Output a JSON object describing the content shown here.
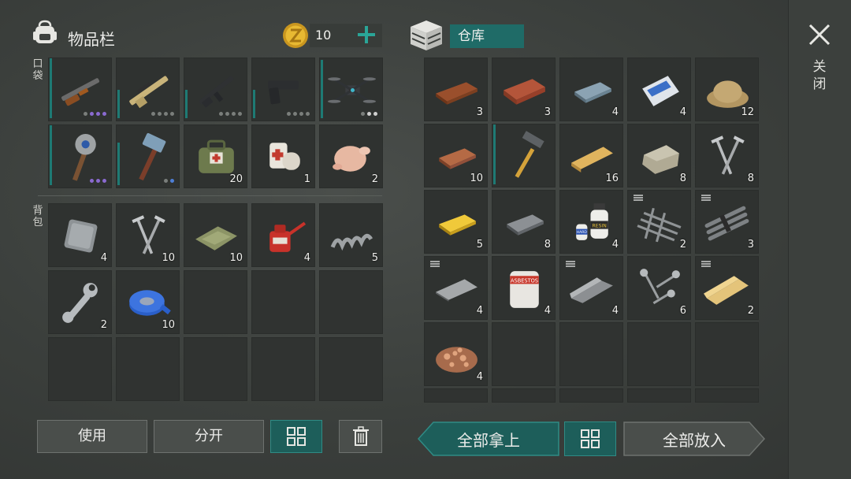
{
  "inventory": {
    "title": "物品栏",
    "coins": "10",
    "pocket_label": "口袋",
    "backpack_label": "背包",
    "pocket_slots": [
      {
        "icon": "shotgun-icon",
        "qty": "",
        "dots": [
          "off",
          "on",
          "on",
          "on"
        ]
      },
      {
        "icon": "rifle-icon",
        "qty": "",
        "dots": [
          "off",
          "off",
          "off",
          "off"
        ]
      },
      {
        "icon": "assault-rifle-icon",
        "qty": "",
        "dots": [
          "off",
          "off",
          "off",
          "off"
        ]
      },
      {
        "icon": "pistol-icon",
        "qty": "",
        "dots": [
          "off",
          "off",
          "off",
          "off"
        ]
      },
      {
        "icon": "drone-icon",
        "qty": "",
        "dots": [
          "off",
          "white",
          "white"
        ]
      },
      {
        "icon": "saw-blade-club-icon",
        "qty": "",
        "dots": [
          "on",
          "on",
          "on"
        ]
      },
      {
        "icon": "sledgehammer-icon",
        "qty": "",
        "dots": [
          "off",
          "blue"
        ]
      },
      {
        "icon": "medkit-bag-icon",
        "qty": "20",
        "dots": []
      },
      {
        "icon": "bandage-icon",
        "qty": "1",
        "dots": []
      },
      {
        "icon": "raw-chicken-icon",
        "qty": "2",
        "dots": []
      }
    ],
    "backpack_slots": [
      {
        "icon": "metal-plate-icon",
        "qty": "4"
      },
      {
        "icon": "nails-icon",
        "qty": "10"
      },
      {
        "icon": "cloth-icon",
        "qty": "10"
      },
      {
        "icon": "oil-can-icon",
        "qty": "4"
      },
      {
        "icon": "spring-icon",
        "qty": "5"
      },
      {
        "icon": "wrench-icon",
        "qty": "2"
      },
      {
        "icon": "blue-tape-icon",
        "qty": "10"
      }
    ]
  },
  "storage": {
    "title": "仓库",
    "slots": [
      {
        "icon": "wood-plank-icon",
        "qty": "3"
      },
      {
        "icon": "brick-icon",
        "qty": "3"
      },
      {
        "icon": "iron-ingot-icon",
        "qty": "4"
      },
      {
        "icon": "cement-bag-icon",
        "qty": "4"
      },
      {
        "icon": "sand-icon",
        "qty": "12"
      },
      {
        "icon": "copper-ingot-icon",
        "qty": "10"
      },
      {
        "icon": "hammer-icon",
        "qty": ""
      },
      {
        "icon": "wooden-board-icon",
        "qty": "16"
      },
      {
        "icon": "stone-icon",
        "qty": "8"
      },
      {
        "icon": "nails-icon",
        "qty": "8"
      },
      {
        "icon": "gold-ingot-icon",
        "qty": "5"
      },
      {
        "icon": "steel-ingot-icon",
        "qty": "8"
      },
      {
        "icon": "resin-bottles-icon",
        "qty": "4"
      },
      {
        "icon": "rebar-mesh-icon",
        "qty": "2"
      },
      {
        "icon": "rebar-bundle-icon",
        "qty": "3"
      },
      {
        "icon": "steel-sheet-icon",
        "qty": "4"
      },
      {
        "icon": "asbestos-bag-icon",
        "qty": "4"
      },
      {
        "icon": "steel-bar-icon",
        "qty": "4"
      },
      {
        "icon": "screws-icon",
        "qty": "6"
      },
      {
        "icon": "wooden-beam-icon",
        "qty": "2"
      },
      {
        "icon": "wood-chips-icon",
        "qty": "4"
      }
    ],
    "asbestos_text": "ASBESTOS",
    "cement_text": "CEMENT",
    "resin_text": "RESIN",
    "hard_text": "HARD"
  },
  "buttons": {
    "use": "使用",
    "split": "分开",
    "take_all": "全部拿上",
    "put_all": "全部放入"
  },
  "close_label": "关闭",
  "colors": {
    "accent_teal": "#1d5e5a",
    "durability_bar": "#1e7a74",
    "dot_purple": "#8a6ad0",
    "coin_gold": "#e0b32a"
  }
}
